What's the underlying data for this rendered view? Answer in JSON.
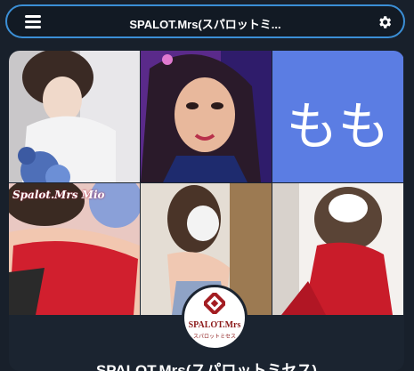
{
  "header": {
    "title": "SPALOT.Mrs(スパロットミ..."
  },
  "gallery": {
    "tiles": [
      {
        "caption": ""
      },
      {
        "caption": ""
      },
      {
        "caption": "もも"
      },
      {
        "caption": "Spalot.Mrs Mio"
      },
      {
        "caption": ""
      },
      {
        "caption": ""
      }
    ]
  },
  "profile": {
    "brand": "SPALOT.Mrs",
    "brand_sub": "スパロットミセス",
    "name_partial": "SPALOT.Mrs(スパロットミセス)"
  },
  "colors": {
    "background": "#18202b",
    "topbar_border": "#3b8fd6",
    "accent_red": "#d11f2e",
    "tile_blue": "#5b7de3"
  },
  "icons": {
    "menu": "hamburger-menu-icon",
    "settings": "gear-icon"
  }
}
